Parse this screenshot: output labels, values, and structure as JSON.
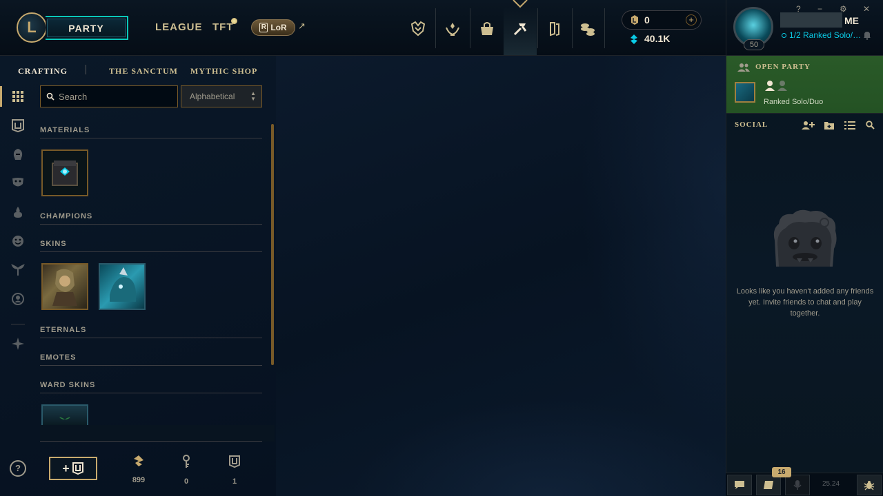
{
  "topbar": {
    "play_label": "PARTY",
    "nav": {
      "league": "LEAGUE",
      "tft": "TFT",
      "lor": "LoR",
      "lor_arrow": "↗"
    },
    "icons": [
      "clash-icon",
      "ranked-icon",
      "profile-icon",
      "loot-icon",
      "collection-icon",
      "store-icon"
    ],
    "riot_points": "0",
    "blue_essence": "40.1K",
    "rp_add": "+"
  },
  "profile": {
    "level": "50",
    "name_suffix": "ME",
    "status": "1/2 Ranked Solo/Duo",
    "window_controls": {
      "help": "?",
      "minimize": "−",
      "settings": "⚙",
      "close": "✕"
    }
  },
  "crafting": {
    "tabs": [
      "CRAFTING",
      "THE SANCTUM",
      "MYTHIC SHOP"
    ],
    "search_placeholder": "Search",
    "sort_value": "Alphabetical",
    "sections": [
      "MATERIALS",
      "CHAMPIONS",
      "SKINS",
      "ETERNALS",
      "EMOTES",
      "WARD SKINS"
    ],
    "footer": {
      "help": "?",
      "add_chest": "+",
      "orange_essence": "899",
      "keys": "0",
      "chests": "1"
    }
  },
  "social": {
    "open_party": "OPEN PARTY",
    "queue": "Ranked Solo/Duo",
    "title": "SOCIAL",
    "empty_message": "Looks like you haven't added any friends yet. Invite friends to chat and play together.",
    "notification_count": "16",
    "version": "25.24"
  },
  "colors": {
    "gold": "#c8aa6e",
    "cyan": "#0ac8b9",
    "party_green": "#2a5a28",
    "bg": "#010a13"
  }
}
